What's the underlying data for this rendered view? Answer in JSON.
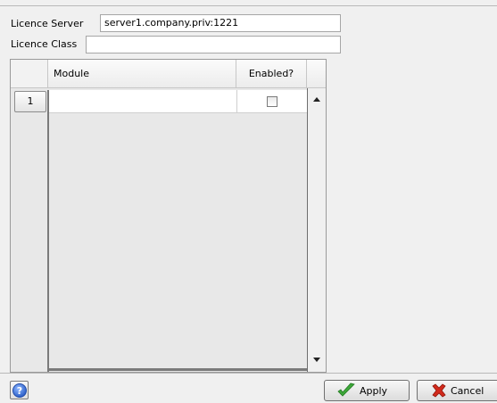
{
  "form": {
    "server_label": "Licence Server",
    "server_value": "server1.company.priv:1221",
    "class_label": "Licence Class",
    "class_value": ""
  },
  "table": {
    "columns": [
      "Module",
      "Enabled?"
    ],
    "rows": [
      {
        "row_number": "1",
        "module": "",
        "enabled": false
      }
    ]
  },
  "footer": {
    "apply_label": "Apply",
    "cancel_label": "Cancel"
  },
  "icons": {
    "help": "help-question-icon",
    "apply": "green-checkmark-icon",
    "cancel": "red-x-icon",
    "scroll_up": "scroll-up-arrow-icon",
    "scroll_down": "scroll-down-arrow-icon"
  },
  "colors": {
    "help_blue": "#3a6fd0",
    "apply_green": "#3da83a",
    "cancel_red": "#d22a1c"
  }
}
